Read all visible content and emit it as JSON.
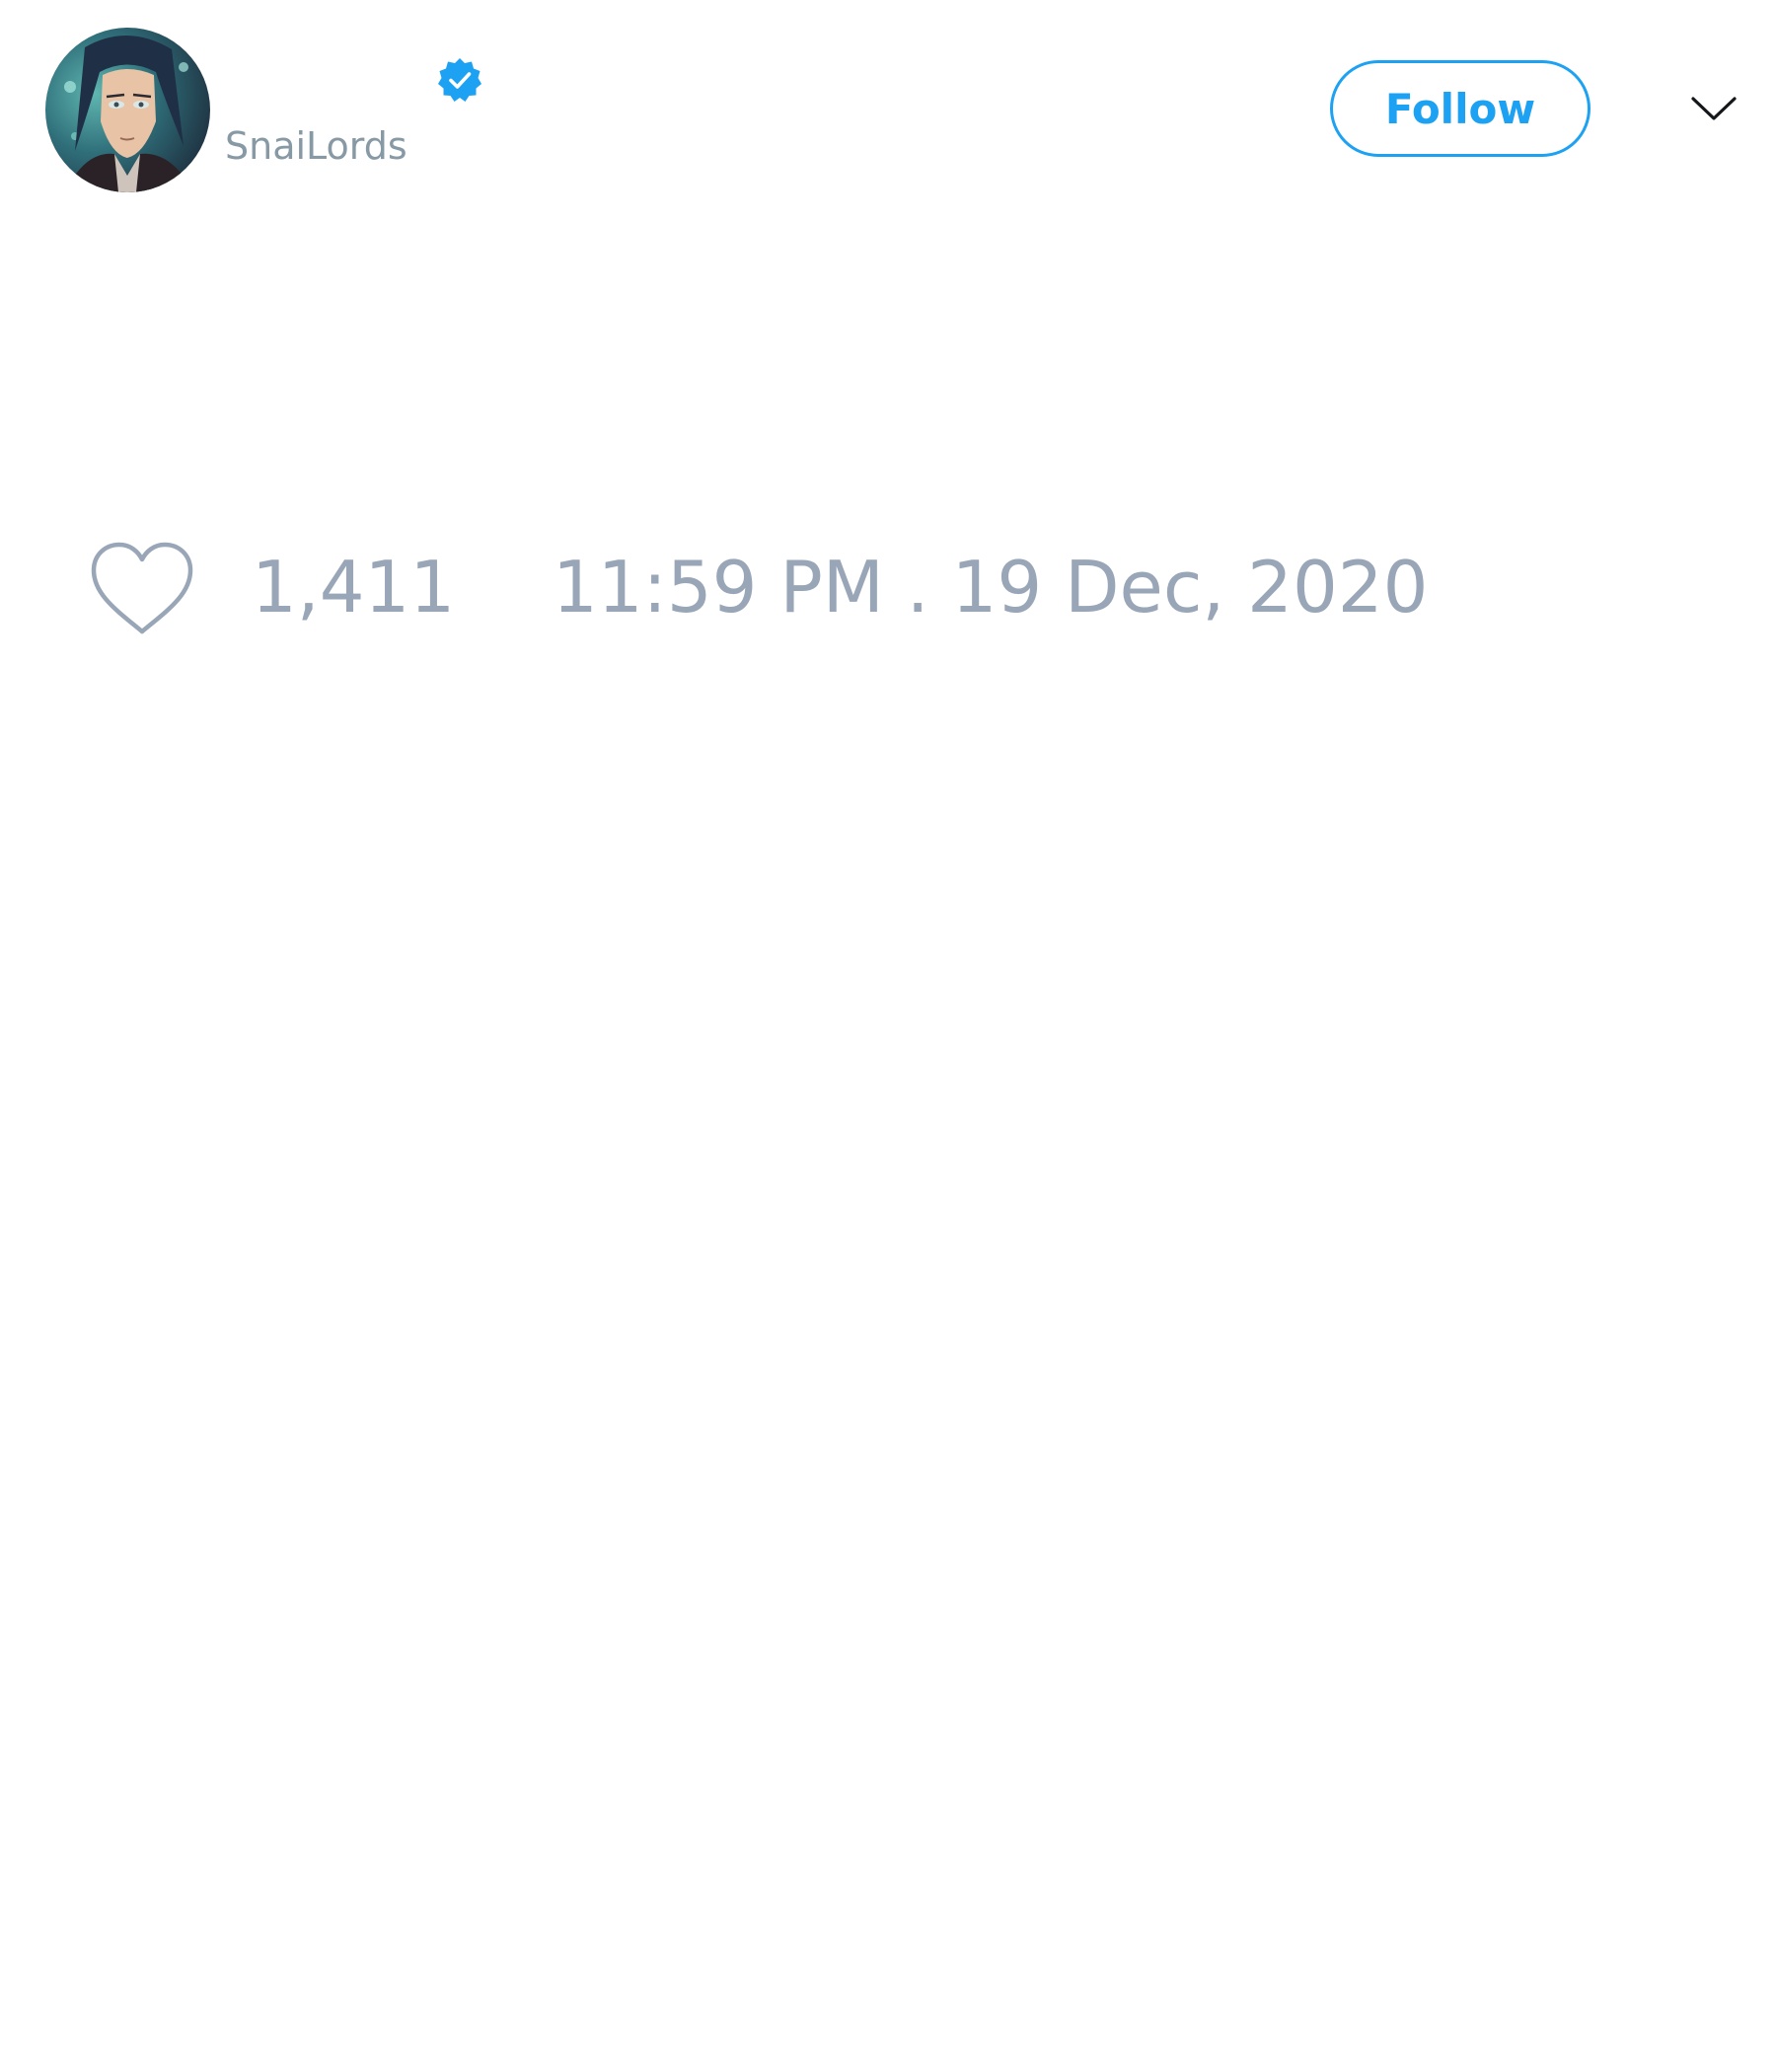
{
  "tweet": {
    "author": {
      "display_name": "",
      "handle": "SnaiLords",
      "verified": true,
      "avatar_icon": "user-avatar-icon"
    },
    "follow_label": "Follow",
    "menu_icon": "chevron-down-icon",
    "likes": {
      "icon": "heart-icon",
      "count": "1,411"
    },
    "timestamp": "11:59 PM . 19 Dec, 2020"
  },
  "colors": {
    "accent": "#1da1f2",
    "muted_text": "#99a6b8",
    "handle_text": "#8899a6",
    "background": "#ffffff"
  }
}
